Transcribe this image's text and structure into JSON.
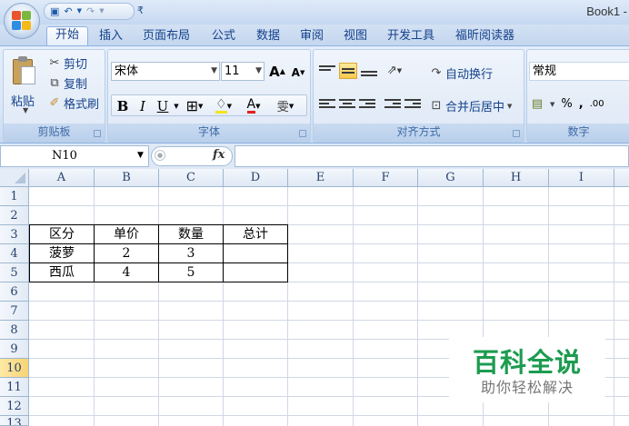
{
  "window": {
    "title": "Book1 -"
  },
  "quick_access": {
    "save_icon": "save-icon",
    "undo_icon": "undo-icon",
    "redo_icon": "redo-icon",
    "customize": "₹"
  },
  "tabs": [
    "开始",
    "插入",
    "页面布局",
    "公式",
    "数据",
    "审阅",
    "视图",
    "开发工具",
    "福昕阅读器"
  ],
  "active_tab": "开始",
  "clipboard": {
    "paste": "粘贴",
    "cut": "剪切",
    "copy": "复制",
    "format_painter": "格式刷",
    "group": "剪贴板"
  },
  "font": {
    "name": "宋体",
    "size": "11",
    "grow": "A",
    "shrink": "A",
    "bold": "B",
    "italic": "I",
    "underline": "U",
    "wen": "雯",
    "group": "字体"
  },
  "alignment": {
    "wrap_text": "自动换行",
    "merge_center": "合并后居中",
    "group": "对齐方式"
  },
  "number": {
    "format": "常规",
    "percent": "%",
    "comma": ",",
    "decimal": ".00",
    "group": "数字"
  },
  "formula_bar": {
    "name_box": "N10",
    "fx": "fx",
    "content": ""
  },
  "columns": [
    "A",
    "B",
    "C",
    "D",
    "E",
    "F",
    "G",
    "H",
    "I"
  ],
  "rows": [
    "1",
    "2",
    "3",
    "4",
    "5",
    "6",
    "7",
    "8",
    "9",
    "10",
    "11",
    "12",
    "13"
  ],
  "selected_row": "10",
  "cells": {
    "A3": "区分",
    "B3": "单价",
    "C3": "数量",
    "D3": "总计",
    "A4": "菠萝",
    "B4": "2",
    "C4": "3",
    "A5": "西瓜",
    "B5": "4",
    "C5": "5"
  },
  "watermark": {
    "title": "百科全说",
    "subtitle": "助你轻松解决"
  },
  "colors": {
    "accent": "#15428b",
    "selected_row": "#f8d474",
    "watermark": "#1c9c50"
  }
}
